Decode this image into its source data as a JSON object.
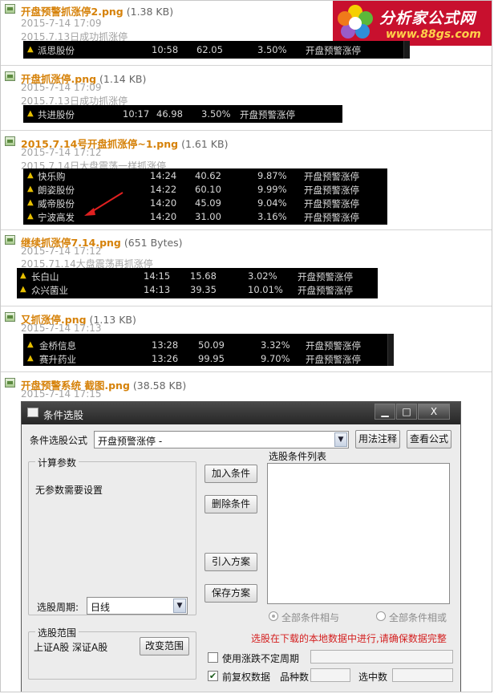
{
  "logo": {
    "title": "分析家公式网",
    "url": "www.88gs.com"
  },
  "entries": [
    {
      "name": "开盘预警抓涨停2.png",
      "size": "(1.38 KB)",
      "date": "2015-7-14 17:09",
      "desc": "2015.7.13日成功抓涨停",
      "rows": [
        {
          "stock": "派思股份",
          "time": "10:58",
          "price": "62.05",
          "pct": "3.50%",
          "note": "开盘预警涨停"
        }
      ]
    },
    {
      "name": "开盘抓涨停.png",
      "size": "(1.14 KB)",
      "date": "2015-7-14 17:09",
      "desc": "2015.7.13日成功抓涨停",
      "rows": [
        {
          "stock": "共进股份",
          "time": "10:17",
          "price": "46.98",
          "pct": "3.50%",
          "note": "开盘预警涨停"
        }
      ]
    },
    {
      "name": "2015.7.14号开盘抓涨停~1.png",
      "size": "(1.61 KB)",
      "date": "2015-7-14 17:12",
      "desc": "2015.7.14日大盘震荡一样抓涨停",
      "rows": [
        {
          "stock": "快乐购",
          "time": "14:24",
          "price": "40.62",
          "pct": "9.87%",
          "note": "开盘预警涨停"
        },
        {
          "stock": "朗姿股份",
          "time": "14:22",
          "price": "60.10",
          "pct": "9.99%",
          "note": "开盘预警涨停"
        },
        {
          "stock": "威帝股份",
          "time": "14:20",
          "price": "45.09",
          "pct": "9.04%",
          "note": "开盘预警涨停"
        },
        {
          "stock": "宁波高发",
          "time": "14:20",
          "price": "31.00",
          "pct": "3.16%",
          "note": "开盘预警涨停"
        }
      ]
    },
    {
      "name": "继续抓涨停7.14.png",
      "size": "(651 Bytes)",
      "date": "2015-7-14 17:12",
      "desc": "2015.71.14大盘震荡再抓涨停",
      "rows": [
        {
          "stock": "长白山",
          "time": "14:15",
          "price": "15.68",
          "pct": "3.02%",
          "note": "开盘预警涨停"
        },
        {
          "stock": "众兴菌业",
          "time": "14:13",
          "price": "39.35",
          "pct": "10.01%",
          "note": "开盘预警涨停"
        }
      ]
    },
    {
      "name": "又抓涨停.png",
      "size": "(1.13 KB)",
      "date": "2015-7-14 17:13",
      "desc": "",
      "rows": [
        {
          "stock": "金桥信息",
          "time": "13:28",
          "price": "50.09",
          "pct": "3.32%",
          "note": "开盘预警涨停"
        },
        {
          "stock": "赛升药业",
          "time": "13:26",
          "price": "99.95",
          "pct": "9.70%",
          "note": "开盘预警涨停"
        }
      ]
    },
    {
      "name": "开盘预警系统 截图.png",
      "size": "(38.58 KB)",
      "date": "2015-7-14 17:15",
      "desc": "",
      "rows": []
    }
  ],
  "dialog": {
    "title": "条件选股",
    "formula_label": "条件选股公式",
    "formula_value": "开盘预警涨停 -",
    "usage_btn": "用法注释",
    "view_btn": "查看公式",
    "params_group": "计算参数",
    "params_note": "无参数需要设置",
    "add_btn": "加入条件",
    "delete_btn": "删除条件",
    "import_btn": "引入方案",
    "save_btn": "保存方案",
    "list_label": "选股条件列表",
    "period_label": "选股周期:",
    "period_value": "日线",
    "range_group": "选股范围",
    "range_value": "上证A股 深证A股",
    "range_btn": "改变范围",
    "radio_and": "全部条件相与",
    "radio_or": "全部条件相或",
    "warning": "选股在下载的本地数据中进行,请确保数据完整",
    "unfixed_label": "使用涨跌不定周期",
    "adjust_label": "前复权数据",
    "count_label": "品种数",
    "selected_label": "选中数",
    "window_close": "X"
  }
}
